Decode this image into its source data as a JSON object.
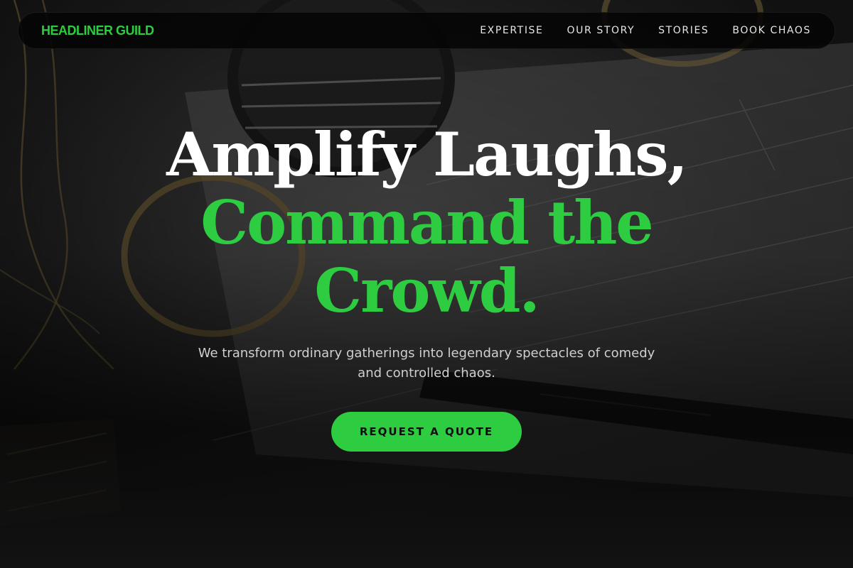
{
  "nav": {
    "brand": "HEADLINER GUILD",
    "links": [
      "EXPERTISE",
      "OUR STORY",
      "STORIES",
      "BOOK CHAOS"
    ]
  },
  "hero": {
    "headline_line1": "Amplify Laughs,",
    "headline_line2": "Command the",
    "headline_line3": "Crowd.",
    "subtext": "We transform ordinary gatherings into legendary spectacles of comedy and controlled chaos.",
    "cta_label": "REQUEST A QUOTE"
  },
  "colors": {
    "accent": "#2ecc40",
    "nav_bg": "#050505",
    "text_light": "#ffffff"
  }
}
